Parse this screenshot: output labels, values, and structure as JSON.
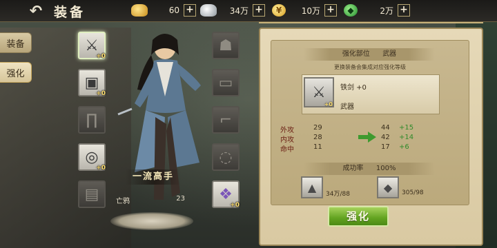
{
  "header": {
    "back_icon": "back-arrow-icon",
    "title": "装备",
    "resources": [
      {
        "icon": "gold-ingot-icon",
        "value": "60"
      },
      {
        "icon": "silver-ingot-icon",
        "value": "34万"
      },
      {
        "icon": "coin-icon",
        "value": "10万"
      },
      {
        "icon": "jade-icon",
        "value": "2万"
      }
    ],
    "plus_label": "+"
  },
  "tabs": [
    {
      "label": "装备"
    },
    {
      "label": "强化"
    }
  ],
  "slots": {
    "left": [
      {
        "icon": "sword-icon",
        "level": "+0",
        "filled": true,
        "selected": true
      },
      {
        "icon": "armor-icon",
        "level": "+0",
        "filled": true
      },
      {
        "icon": "pants-icon",
        "level": "",
        "filled": false
      },
      {
        "icon": "ring-icon",
        "level": "+0",
        "filled": true
      },
      {
        "icon": "bracer-icon",
        "level": "",
        "filled": false
      }
    ],
    "right": [
      {
        "icon": "helmet-icon",
        "level": "",
        "filled": false
      },
      {
        "icon": "belt-icon",
        "level": "",
        "filled": false
      },
      {
        "icon": "boots-icon",
        "level": "",
        "filled": false
      },
      {
        "icon": "necklace-icon",
        "level": "",
        "filled": false
      },
      {
        "icon": "gem-icon",
        "level": "+0",
        "filled": true
      }
    ]
  },
  "character": {
    "name": "一流高手",
    "stat_name": "亡鸦",
    "stat_value": "23"
  },
  "panel": {
    "section_title_prefix": "强化部位",
    "section_title_part": "武器",
    "hint": "更换装备会集成对应强化等级",
    "item": {
      "icon": "sword-icon",
      "level": "+0",
      "name": "铁剑 +0",
      "type": "武器"
    },
    "compare": [
      {
        "name": "外攻",
        "old": "29",
        "new": "44",
        "delta": "+15"
      },
      {
        "name": "内攻",
        "old": "28",
        "new": "42",
        "delta": "+14"
      },
      {
        "name": "命中",
        "old": "11",
        "new": "17",
        "delta": "+6"
      }
    ],
    "rate_label": "成功率",
    "rate_value": "100%",
    "costs": [
      {
        "icon": "silver-ingot-icon",
        "value": "34万/88"
      },
      {
        "icon": "ore-icon",
        "value": "305/98"
      }
    ],
    "button_label": "强化"
  },
  "colors": {
    "accent_green": "#62a320",
    "increase_green": "#2f8a2a",
    "stat_red": "#6b1f14",
    "panel_bg": "#e6d9b8"
  }
}
